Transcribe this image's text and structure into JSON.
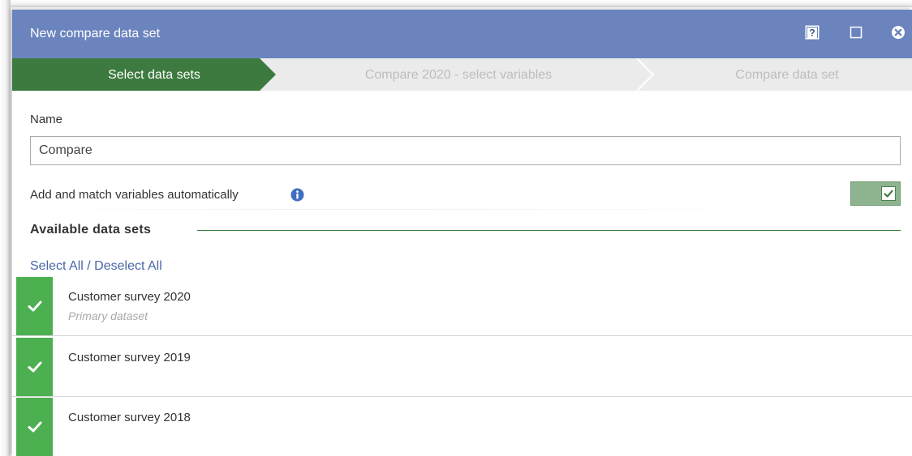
{
  "window": {
    "title": "New compare data set"
  },
  "steps": [
    {
      "label": "Select data sets",
      "active": true
    },
    {
      "label": "Compare 2020 - select variables",
      "active": false
    },
    {
      "label": "Compare data set",
      "active": false
    }
  ],
  "form": {
    "name_label": "Name",
    "name_value": "Compare",
    "auto_match_label": "Add and match variables automatically",
    "auto_match_enabled": true
  },
  "available": {
    "title": "Available data sets",
    "select_all": "Select All",
    "separator": " / ",
    "deselect_all": "Deselect All",
    "items": [
      {
        "name": "Customer survey 2020",
        "subtitle": "Primary dataset",
        "checked": true
      },
      {
        "name": "Customer survey 2019",
        "subtitle": "",
        "checked": true
      },
      {
        "name": "Customer survey 2018",
        "subtitle": "",
        "checked": true
      }
    ]
  },
  "colors": {
    "titlebar": "#6b84be",
    "step_active": "#3d7a3f",
    "step_inactive": "#ebebeb",
    "check_green": "#4caf50",
    "link_blue": "#4a67a8",
    "toggle_bg": "#8db48f"
  },
  "icons": {
    "help": "help-icon",
    "maximize": "maximize-icon",
    "close": "close-icon",
    "info": "info-icon",
    "check": "checkmark-icon"
  }
}
